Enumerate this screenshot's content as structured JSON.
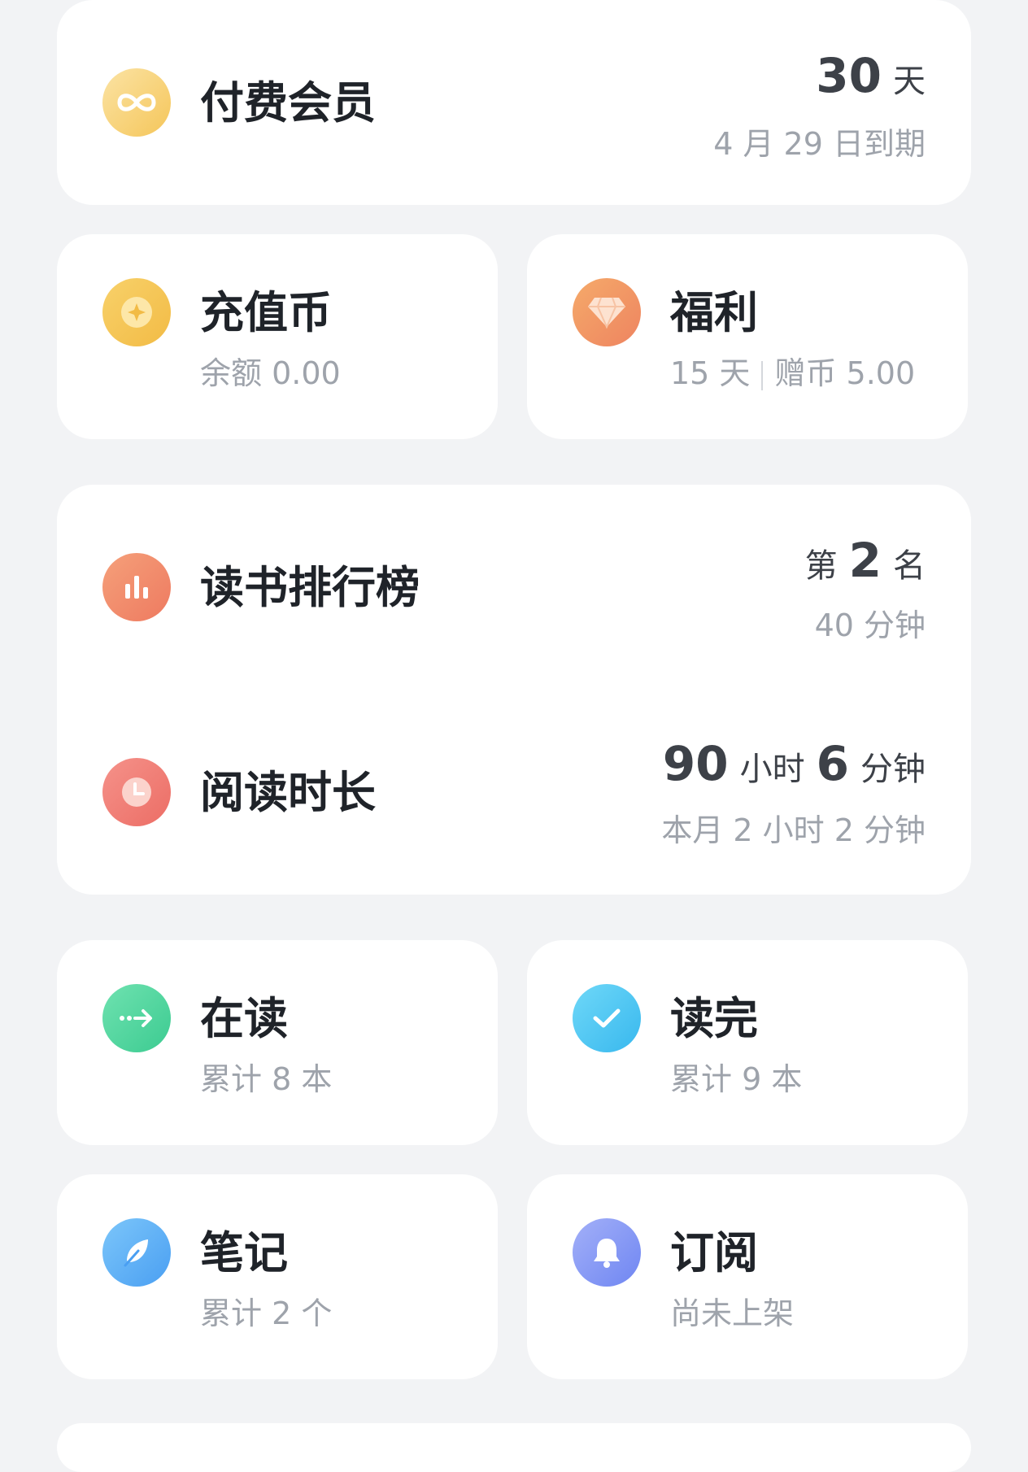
{
  "membership": {
    "title": "付费会员",
    "days_value": "30",
    "days_unit": "天",
    "expiry": "4 月 29 日到期",
    "icon": "infinity-icon"
  },
  "recharge": {
    "title": "充值币",
    "balance": "余额 0.00",
    "icon": "coin-icon"
  },
  "welfare": {
    "title": "福利",
    "days": "15 天",
    "bonus": "赠币 5.00",
    "icon": "diamond-icon"
  },
  "ranking": {
    "title": "读书排行榜",
    "prefix": "第",
    "rank": "2",
    "suffix": "名",
    "minutes": "40 分钟",
    "icon": "bar-chart-icon"
  },
  "reading_time": {
    "title": "阅读时长",
    "hours": "90",
    "hours_unit": "小时",
    "minutes": "6",
    "minutes_unit": "分钟",
    "this_month": "本月 2 小时 2 分钟",
    "icon": "clock-icon"
  },
  "reading": {
    "title": "在读",
    "count": "累计 8 本",
    "icon": "arrow-right-icon"
  },
  "finished": {
    "title": "读完",
    "count": "累计 9 本",
    "icon": "check-icon"
  },
  "notes": {
    "title": "笔记",
    "count": "累计 2 个",
    "icon": "feather-icon"
  },
  "subscription": {
    "title": "订阅",
    "status": "尚未上架",
    "icon": "bell-icon"
  },
  "colors": {
    "background": "#f2f3f5",
    "card": "#ffffff",
    "gold": "#f5c65a",
    "orange": "#f0905a",
    "coral": "#ee8470",
    "green": "#4fd6a0",
    "cyan": "#4fc8f0",
    "blue": "#5aaef5",
    "indigo": "#7a92f5"
  }
}
